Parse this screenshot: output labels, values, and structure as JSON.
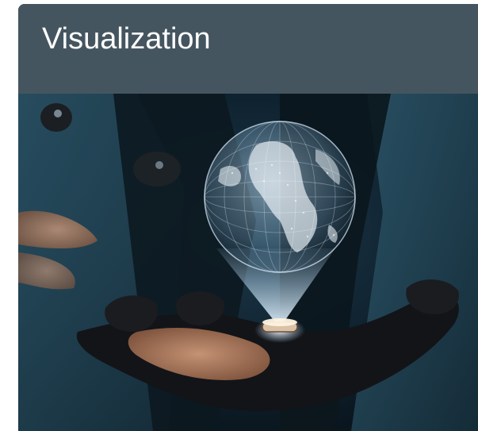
{
  "card": {
    "title": "Visualization",
    "image_subject": "hands-holding-holographic-globe",
    "colors": {
      "header_background": "#455560",
      "title_text": "#ffffff",
      "hologram_glow": "#cfe8ff"
    }
  }
}
